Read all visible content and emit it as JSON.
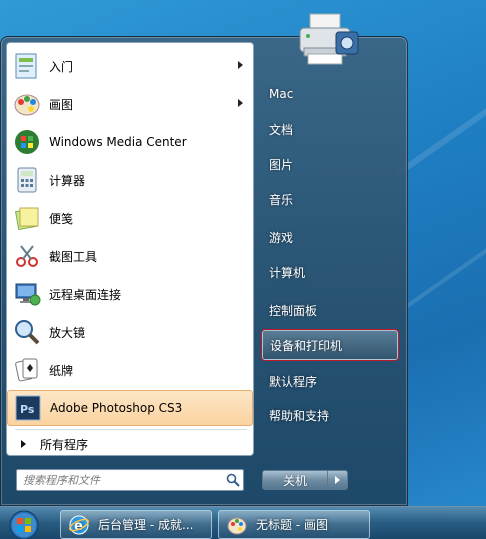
{
  "start_menu": {
    "programs": [
      {
        "label": "入门",
        "icon": "getting-started-icon",
        "submenu": true
      },
      {
        "label": "画图",
        "icon": "paint-icon",
        "submenu": true
      },
      {
        "label": "Windows Media Center",
        "icon": "media-center-icon",
        "submenu": false
      },
      {
        "label": "计算器",
        "icon": "calculator-icon",
        "submenu": false
      },
      {
        "label": "便笺",
        "icon": "sticky-notes-icon",
        "submenu": false
      },
      {
        "label": "截图工具",
        "icon": "snipping-tool-icon",
        "submenu": false
      },
      {
        "label": "远程桌面连接",
        "icon": "remote-desktop-icon",
        "submenu": false
      },
      {
        "label": "放大镜",
        "icon": "magnifier-icon",
        "submenu": false
      },
      {
        "label": "纸牌",
        "icon": "solitaire-icon",
        "submenu": false
      },
      {
        "label": "Adobe Photoshop CS3",
        "icon": "photoshop-icon",
        "submenu": false,
        "highlighted": true
      }
    ],
    "all_programs_label": "所有程序",
    "search_placeholder": "搜索程序和文件",
    "right_items": [
      {
        "label": "Mac"
      },
      {
        "label": "文档"
      },
      {
        "label": "图片"
      },
      {
        "label": "音乐"
      },
      {
        "label": "游戏"
      },
      {
        "label": "计算机"
      },
      {
        "label": "控制面板"
      },
      {
        "label": "设备和打印机",
        "selected": true
      },
      {
        "label": "默认程序"
      },
      {
        "label": "帮助和支持"
      }
    ],
    "shutdown_label": "关机"
  },
  "taskbar": {
    "buttons": [
      {
        "label": "后台管理 - 成就...",
        "icon": "ie-icon"
      },
      {
        "label": "无标题 - 画图",
        "icon": "paint-icon"
      }
    ]
  },
  "colors": {
    "highlight": "#fbd3a0",
    "selected_outline": "#c0182b",
    "desktop": "#1f7fc3"
  }
}
